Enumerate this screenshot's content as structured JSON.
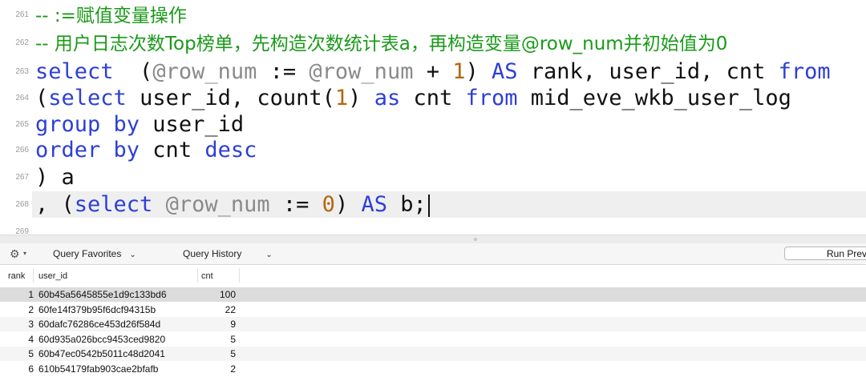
{
  "editor": {
    "lines": [
      {
        "n": "261",
        "parts": [
          {
            "t": "-- :=赋值变量操作",
            "c": "cm"
          }
        ]
      },
      {
        "n": "262",
        "parts": [
          {
            "t": "-- 用户日志次数Top榜单，先构造次数统计表a，再构造变量@row_num并初始值为0",
            "c": "cm"
          }
        ]
      },
      {
        "n": "263",
        "parts": [
          {
            "t": "select",
            "c": "kw"
          },
          {
            "t": "  (",
            "c": ""
          },
          {
            "t": "@row_num",
            "c": "var"
          },
          {
            "t": " := ",
            "c": ""
          },
          {
            "t": "@row_num",
            "c": "var"
          },
          {
            "t": " + ",
            "c": ""
          },
          {
            "t": "1",
            "c": "num"
          },
          {
            "t": ") ",
            "c": ""
          },
          {
            "t": "AS",
            "c": "kw"
          },
          {
            "t": " rank, user_id, cnt ",
            "c": ""
          },
          {
            "t": "from",
            "c": "kw"
          }
        ]
      },
      {
        "n": "264",
        "parts": [
          {
            "t": "(",
            "c": ""
          },
          {
            "t": "select",
            "c": "kw"
          },
          {
            "t": " user_id, count(",
            "c": ""
          },
          {
            "t": "1",
            "c": "num"
          },
          {
            "t": ") ",
            "c": ""
          },
          {
            "t": "as",
            "c": "kw"
          },
          {
            "t": " cnt ",
            "c": ""
          },
          {
            "t": "from",
            "c": "kw"
          },
          {
            "t": " mid_eve_wkb_user_log",
            "c": ""
          }
        ]
      },
      {
        "n": "265",
        "parts": [
          {
            "t": "group by",
            "c": "kw"
          },
          {
            "t": " user_id",
            "c": ""
          }
        ]
      },
      {
        "n": "266",
        "parts": [
          {
            "t": "order by",
            "c": "kw"
          },
          {
            "t": " cnt ",
            "c": ""
          },
          {
            "t": "desc",
            "c": "kw"
          }
        ]
      },
      {
        "n": "267",
        "parts": [
          {
            "t": ") a",
            "c": ""
          }
        ]
      },
      {
        "n": "268",
        "parts": [
          {
            "t": ", (",
            "c": ""
          },
          {
            "t": "select",
            "c": "kw"
          },
          {
            "t": " ",
            "c": ""
          },
          {
            "t": "@row_num",
            "c": "var"
          },
          {
            "t": " := ",
            "c": ""
          },
          {
            "t": "0",
            "c": "num"
          },
          {
            "t": ") ",
            "c": ""
          },
          {
            "t": "AS",
            "c": "kw"
          },
          {
            "t": " b;",
            "c": ""
          }
        ],
        "caret": true
      },
      {
        "n": "269",
        "parts": []
      }
    ]
  },
  "toolbar": {
    "favorites_label": "Query Favorites",
    "history_label": "Query History",
    "run_label": "Run Prev"
  },
  "results": {
    "columns": [
      "rank",
      "user_id",
      "cnt"
    ],
    "rows": [
      [
        "1",
        "60b45a5645855e1d9c133bd6",
        "100"
      ],
      [
        "2",
        "60fe14f379b95f6dcf94315b",
        "22"
      ],
      [
        "3",
        "60dafc76286ce453d26f584d",
        "9"
      ],
      [
        "4",
        "60d935a026bcc9453ced9820",
        "5"
      ],
      [
        "5",
        "60b47ec0542b5011c48d2041",
        "5"
      ],
      [
        "6",
        "610b54179fab903cae2bfafb",
        "2"
      ]
    ]
  }
}
